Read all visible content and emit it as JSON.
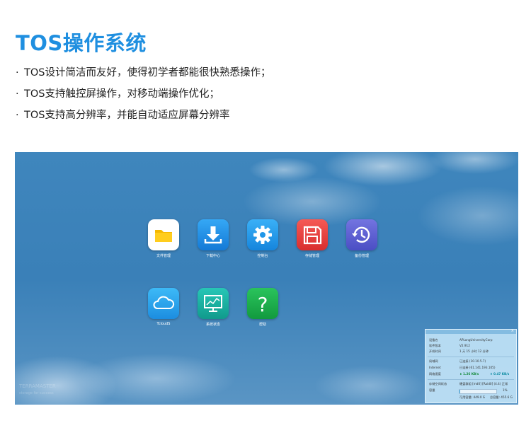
{
  "heading": "TOS操作系统",
  "bullets": [
    "TOS设计简洁而友好，使得初学者都能很快熟悉操作；",
    "TOS支持触控屏操作，对移动端操作优化；",
    "TOS支持高分辨率，并能自动适应屏幕分辨率"
  ],
  "bullet_mark": "·",
  "desktop": {
    "apps": [
      {
        "label": "文件管理",
        "icon": "folder-icon",
        "color": "#ffffff"
      },
      {
        "label": "下载中心",
        "icon": "download-icon",
        "color": "#1c8fe8"
      },
      {
        "label": "控制台",
        "icon": "gear-icon",
        "color": "#1f9ff0"
      },
      {
        "label": "存储管理",
        "icon": "floppy-disk-icon",
        "color": "#ee3f3f"
      },
      {
        "label": "备份管理",
        "icon": "history-clock-icon",
        "color": "#5a5ed0"
      },
      {
        "label": "TcloudS",
        "icon": "cloud-icon",
        "color": "#2aa6ee"
      },
      {
        "label": "系统状态",
        "icon": "monitor-chart-icon",
        "color": "#15b8a8"
      },
      {
        "label": "帮助",
        "icon": "question-icon",
        "color": "#18b04a"
      }
    ],
    "watermark_line1": "TERRAMASTER",
    "watermark_line2": "storage for success"
  },
  "system_info": {
    "close": "×",
    "rows": [
      {
        "k": "设备名",
        "v": "APLongUniversityCorp"
      },
      {
        "k": "软件版本",
        "v": "V2.912"
      },
      {
        "k": "开机时间",
        "v": "1 天 15 小时 12 分钟"
      },
      {
        "k": "局域网",
        "v": "已连接 (10.10.5.7)"
      },
      {
        "k": "Internet",
        "v": "已连接 (61.141.193.105)"
      }
    ],
    "speed_label": "网络速度",
    "speed_down": "1.26 KB/s",
    "speed_up": "0.47 KB/s",
    "storage_label": "存储空间状态",
    "storage_value": "硬盘群组 [md0] [Raid0] (4.4) 正常",
    "capacity_label": "容量",
    "capacity_percent": "1%",
    "capacity_fraction": 0.01,
    "available": "可用容量: 449.0 G",
    "total": "总容量: 455.6 G"
  }
}
